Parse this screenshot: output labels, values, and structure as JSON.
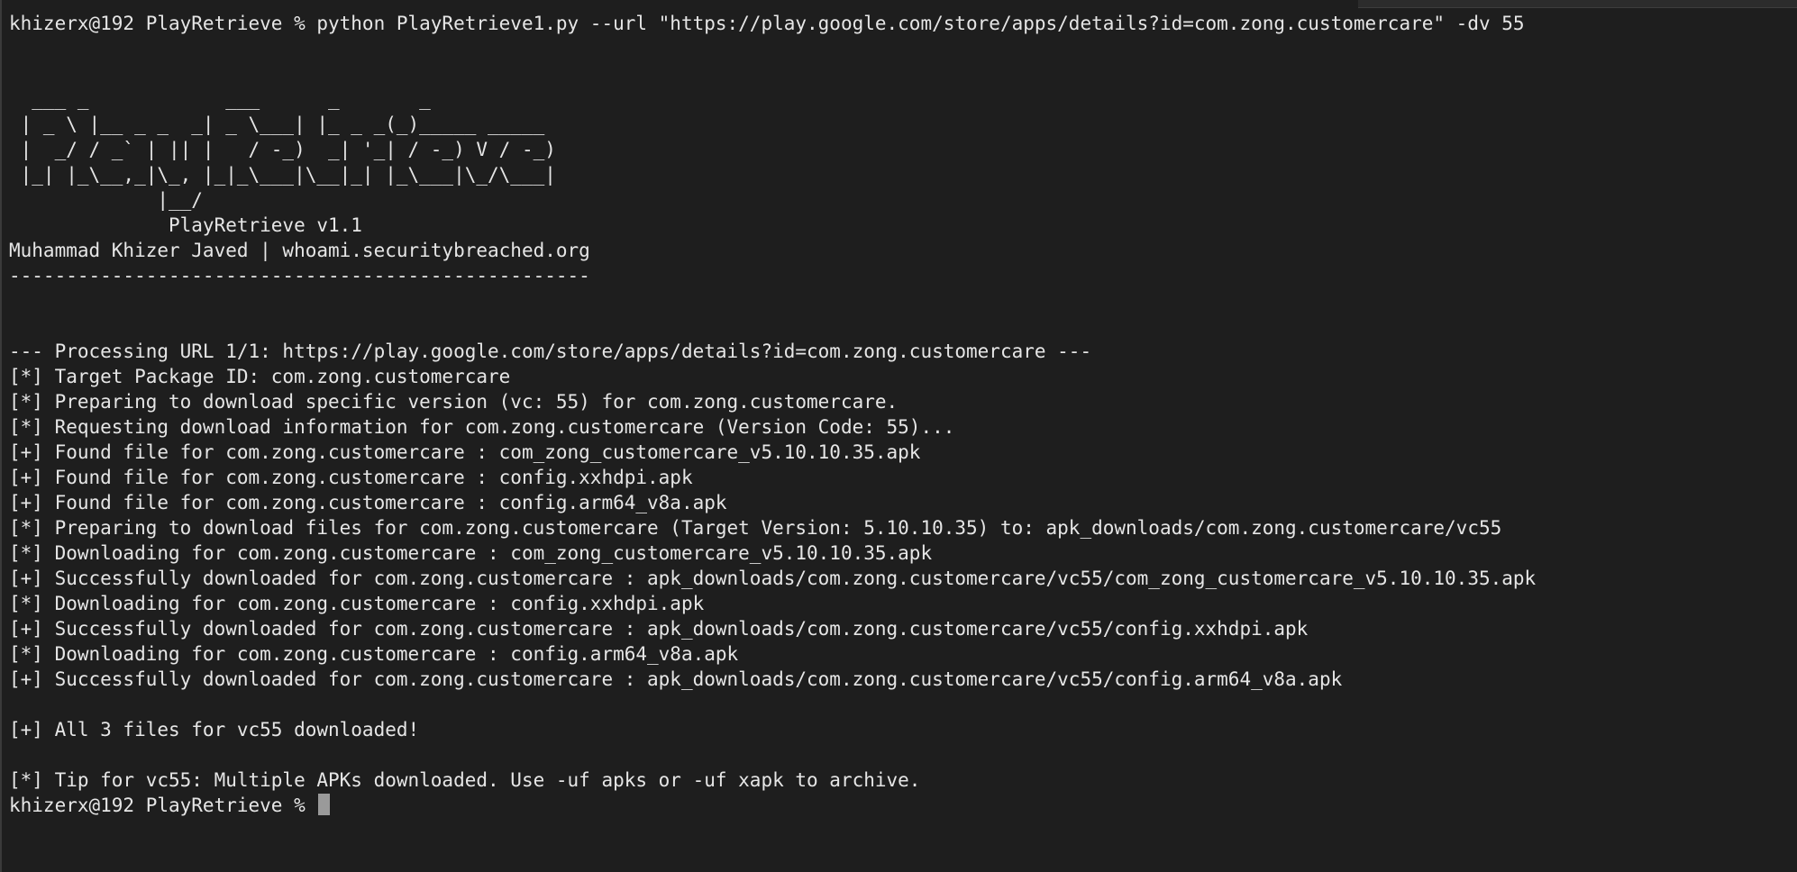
{
  "terminal": {
    "lines": [
      "khizerx@192 PlayRetrieve % python PlayRetrieve1.py --url \"https://play.google.com/store/apps/details?id=com.zong.customercare\" -dv 55",
      "",
      "",
      "  ___ _            ___      _       _",
      " | _ \\ |__ _ _  _| _ \\___| |_ _ _(_)_____ _____",
      " |  _/ / _` | || |   / -_)  _| '_| / -_) V / -_)",
      " |_| |_\\__,_|\\_, |_|_\\___|\\__|_| |_\\___|\\_/\\___|",
      "             |__/",
      "              PlayRetrieve v1.1",
      "Muhammad Khizer Javed | whoami.securitybreached.org",
      "---------------------------------------------------",
      "",
      "",
      "--- Processing URL 1/1: https://play.google.com/store/apps/details?id=com.zong.customercare ---",
      "[*] Target Package ID: com.zong.customercare",
      "[*] Preparing to download specific version (vc: 55) for com.zong.customercare.",
      "[*] Requesting download information for com.zong.customercare (Version Code: 55)...",
      "[+] Found file for com.zong.customercare : com_zong_customercare_v5.10.10.35.apk",
      "[+] Found file for com.zong.customercare : config.xxhdpi.apk",
      "[+] Found file for com.zong.customercare : config.arm64_v8a.apk",
      "[*] Preparing to download files for com.zong.customercare (Target Version: 5.10.10.35) to: apk_downloads/com.zong.customercare/vc55",
      "[*] Downloading for com.zong.customercare : com_zong_customercare_v5.10.10.35.apk",
      "[+] Successfully downloaded for com.zong.customercare : apk_downloads/com.zong.customercare/vc55/com_zong_customercare_v5.10.10.35.apk",
      "[*] Downloading for com.zong.customercare : config.xxhdpi.apk",
      "[+] Successfully downloaded for com.zong.customercare : apk_downloads/com.zong.customercare/vc55/config.xxhdpi.apk",
      "[*] Downloading for com.zong.customercare : config.arm64_v8a.apk",
      "[+] Successfully downloaded for com.zong.customercare : apk_downloads/com.zong.customercare/vc55/config.arm64_v8a.apk",
      "",
      "[+] All 3 files for vc55 downloaded!",
      "",
      "[*] Tip for vc55: Multiple APKs downloaded. Use -uf apks or -uf xapk to archive."
    ],
    "prompt": "khizerx@192 PlayRetrieve % "
  },
  "colors": {
    "background": "#1e1e1e",
    "text": "#e6e6e6",
    "cursor": "#9a9a9a"
  }
}
